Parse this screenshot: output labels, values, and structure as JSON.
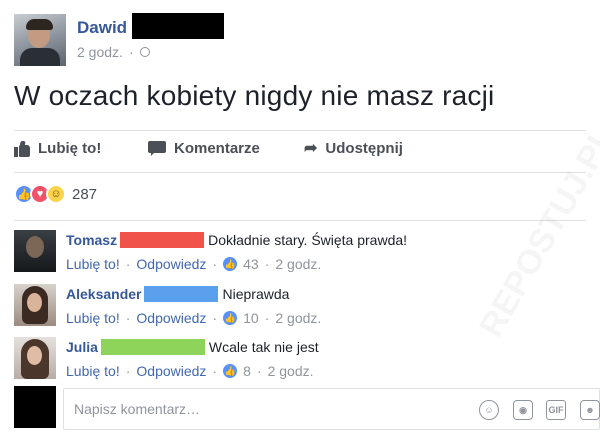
{
  "post": {
    "author": "Dawid",
    "time": "2 godz.",
    "text": "W oczach kobiety nigdy nie masz racji"
  },
  "actions": {
    "like": "Lubię to!",
    "comment": "Komentarze",
    "share": "Udostępnij"
  },
  "reactions": {
    "count": "287",
    "types": [
      "like",
      "love",
      "haha"
    ]
  },
  "comments": [
    {
      "name": "Tomasz",
      "redaction_color": "#f0534a",
      "text": "Dokładnie stary. Święta prawda!",
      "like": "Lubię to!",
      "reply": "Odpowiedz",
      "likes": "43",
      "time": "2 godz."
    },
    {
      "name": "Aleksander",
      "redaction_color": "#5aa0ec",
      "text": "Nieprawda",
      "like": "Lubię to!",
      "reply": "Odpowiedz",
      "likes": "10",
      "time": "2 godz."
    },
    {
      "name": "Julia",
      "redaction_color": "#8fd45a",
      "text": "Wcale tak nie jest",
      "like": "Lubię to!",
      "reply": "Odpowiedz",
      "likes": "8",
      "time": "2 godz."
    }
  ],
  "composer": {
    "placeholder": "Napisz komentarz…",
    "gif_label": "GIF"
  },
  "colors": {
    "link": "#365899",
    "meta": "#90949c",
    "like_blue": "#5890ff"
  }
}
